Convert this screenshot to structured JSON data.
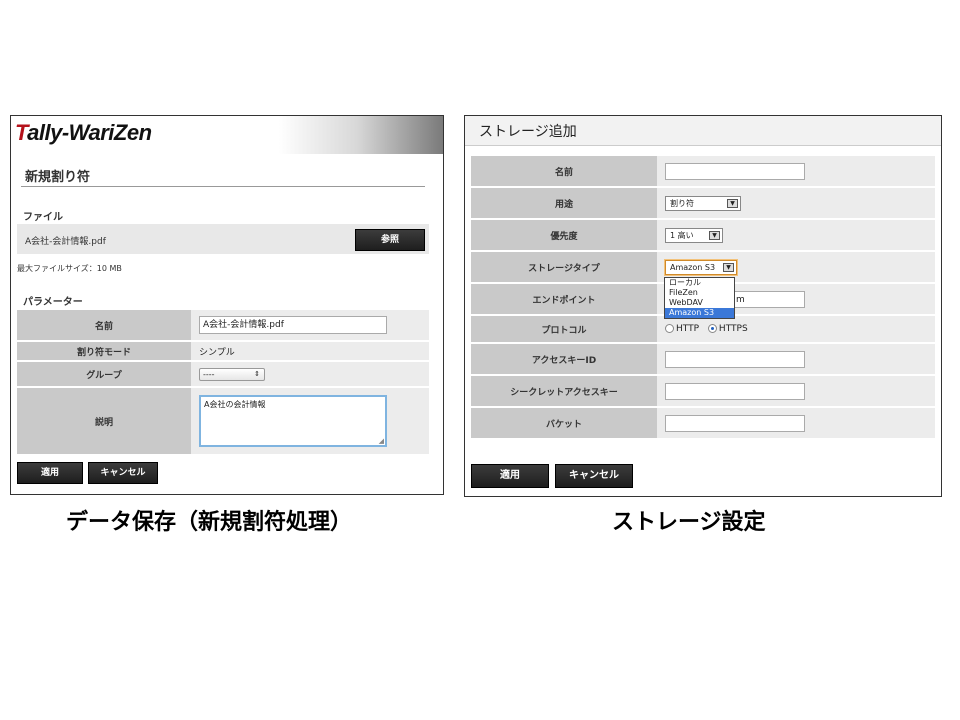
{
  "left": {
    "logo": {
      "first_letter": "T",
      "rest": "ally-WariZen"
    },
    "page_title": "新規割り符",
    "file_section": "ファイル",
    "file_name": "A会社-会計情報.pdf",
    "browse_label": "参照",
    "max_size": "最大ファイルサイズ：10 MB",
    "param_section": "パラメーター",
    "rows": {
      "name_label": "名前",
      "name_value": "A会社-会計情報.pdf",
      "mode_label": "割り符モード",
      "mode_value": "シンプル",
      "group_label": "グループ",
      "group_value": "----",
      "desc_label": "説明",
      "desc_value": "A会社の会計情報"
    },
    "apply_label": "適用",
    "cancel_label": "キャンセル"
  },
  "right": {
    "title": "ストレージ追加",
    "rows": {
      "name_label": "名前",
      "usage_label": "用途",
      "usage_value": "割り符",
      "priority_label": "優先度",
      "priority_value": "1 高い",
      "storage_type_label": "ストレージタイプ",
      "storage_type_value": "Amazon S3",
      "endpoint_label": "エンドポイント",
      "endpoint_value": "m",
      "protocol_label": "プロトコル",
      "protocol_http": "HTTP",
      "protocol_https": "HTTPS",
      "access_key_label": "アクセスキーID",
      "secret_key_label": "シークレットアクセスキー",
      "bucket_label": "バケット"
    },
    "storage_options": [
      "ローカル",
      "FileZen",
      "WebDAV",
      "Amazon S3"
    ],
    "storage_selected_index": 3,
    "protocol_selected": "HTTPS",
    "apply_label": "適用",
    "cancel_label": "キャンセル"
  },
  "captions": {
    "left": "データ保存（新規割符処理）",
    "right": "ストレージ設定"
  },
  "colors": {
    "logo_accent": "#b5121b",
    "label_cell": "#c9c9c9",
    "value_cell": "#ececec",
    "dropdown_highlight": "#3b78d8"
  }
}
